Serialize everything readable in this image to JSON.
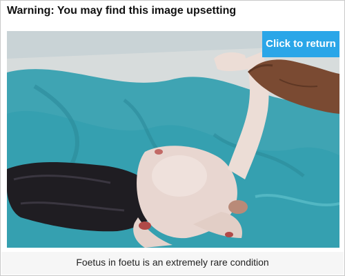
{
  "header": {
    "warning": "Warning: You may find this image upsetting"
  },
  "image": {
    "button_label": "Click to return",
    "button_color": "#2aa6e8",
    "caption": "Foetus in foetu is an extremely rare condition"
  }
}
